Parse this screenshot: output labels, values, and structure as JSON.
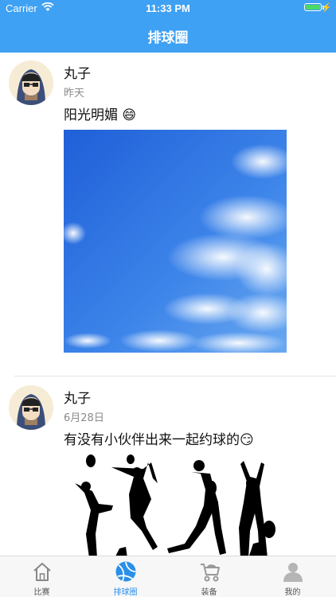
{
  "status_bar": {
    "carrier": "Carrier",
    "time": "11:33 PM"
  },
  "nav": {
    "title": "排球圈"
  },
  "posts": [
    {
      "author": "丸子",
      "time": "昨天",
      "text": "阳光明媚 😄",
      "image": "sky-photo"
    },
    {
      "author": "丸子",
      "time": "6月28日",
      "text": "有没有小伙伴出来一起约球的😏",
      "image": "volleyball-silhouettes-photo"
    }
  ],
  "tabs": [
    {
      "label": "比赛",
      "icon": "home-icon",
      "active": false
    },
    {
      "label": "排球圈",
      "icon": "volleyball-icon",
      "active": true
    },
    {
      "label": "装备",
      "icon": "stroller-icon",
      "active": false
    },
    {
      "label": "我的",
      "icon": "person-icon",
      "active": false
    }
  ],
  "colors": {
    "brand": "#3ea1f3",
    "active_tab": "#2a8fe8",
    "battery": "#4cd964"
  }
}
